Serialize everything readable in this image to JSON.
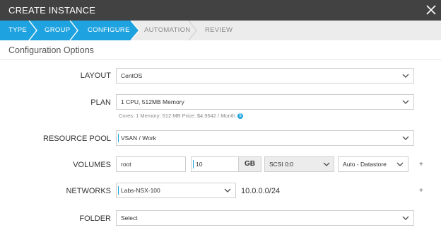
{
  "header": {
    "title": "CREATE INSTANCE"
  },
  "wizard": {
    "steps": [
      {
        "label": "TYPE"
      },
      {
        "label": "GROUP"
      },
      {
        "label": "CONFIGURE"
      },
      {
        "label": "AUTOMATION"
      },
      {
        "label": "REVIEW"
      }
    ],
    "active_index": 2
  },
  "section": {
    "title": "Configuration Options"
  },
  "form": {
    "layout": {
      "label": "LAYOUT",
      "value": "CentOS"
    },
    "plan": {
      "label": "PLAN",
      "value": "1 CPU, 512MB Memory",
      "hint": "Cores: 1   Memory: 512 MB   Price: $4.9642 / Month",
      "badge": "$"
    },
    "resource_pool": {
      "label": "RESOURCE POOL",
      "value": "VSAN / Work"
    },
    "volumes": {
      "label": "VOLUMES",
      "name": "root",
      "size": "10",
      "unit": "GB",
      "controller": "SCSI 0:0",
      "datastore": "Auto - Datastore",
      "add": "+"
    },
    "networks": {
      "label": "NETWORKS",
      "value": "Labs-NSX-100",
      "ip": "10.0.0.0/24",
      "add": "+"
    },
    "folder": {
      "label": "FOLDER",
      "value": "Select"
    }
  },
  "colors": {
    "accent": "#1fa3e0",
    "header_bg": "#424242",
    "wizard_bg": "#ececec"
  }
}
